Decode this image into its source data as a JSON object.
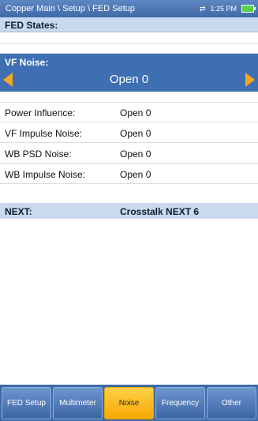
{
  "header": {
    "breadcrumb": "Copper Main \\ Setup \\ FED Setup",
    "time": "1:25 PM"
  },
  "section": {
    "title": "FED States:"
  },
  "selected": {
    "label": "VF Noise:",
    "value": "Open 0"
  },
  "rows": [
    {
      "label": "Power Influence:",
      "value": "Open 0"
    },
    {
      "label": "VF Impulse Noise:",
      "value": "Open 0"
    },
    {
      "label": "WB PSD Noise:",
      "value": "Open 0"
    },
    {
      "label": "WB Impulse Noise:",
      "value": "Open 0"
    }
  ],
  "next_row": {
    "label": "NEXT:",
    "value": "Crosstalk NEXT 6"
  },
  "tabs": [
    {
      "label": "FED Setup"
    },
    {
      "label": "Multimeter"
    },
    {
      "label": "Noise"
    },
    {
      "label": "Frequency"
    },
    {
      "label": "Other"
    }
  ],
  "active_tab": "Noise",
  "colors": {
    "accent": "#f5a623",
    "selection": "#3e6fb2",
    "header": "#c9d9ee"
  }
}
